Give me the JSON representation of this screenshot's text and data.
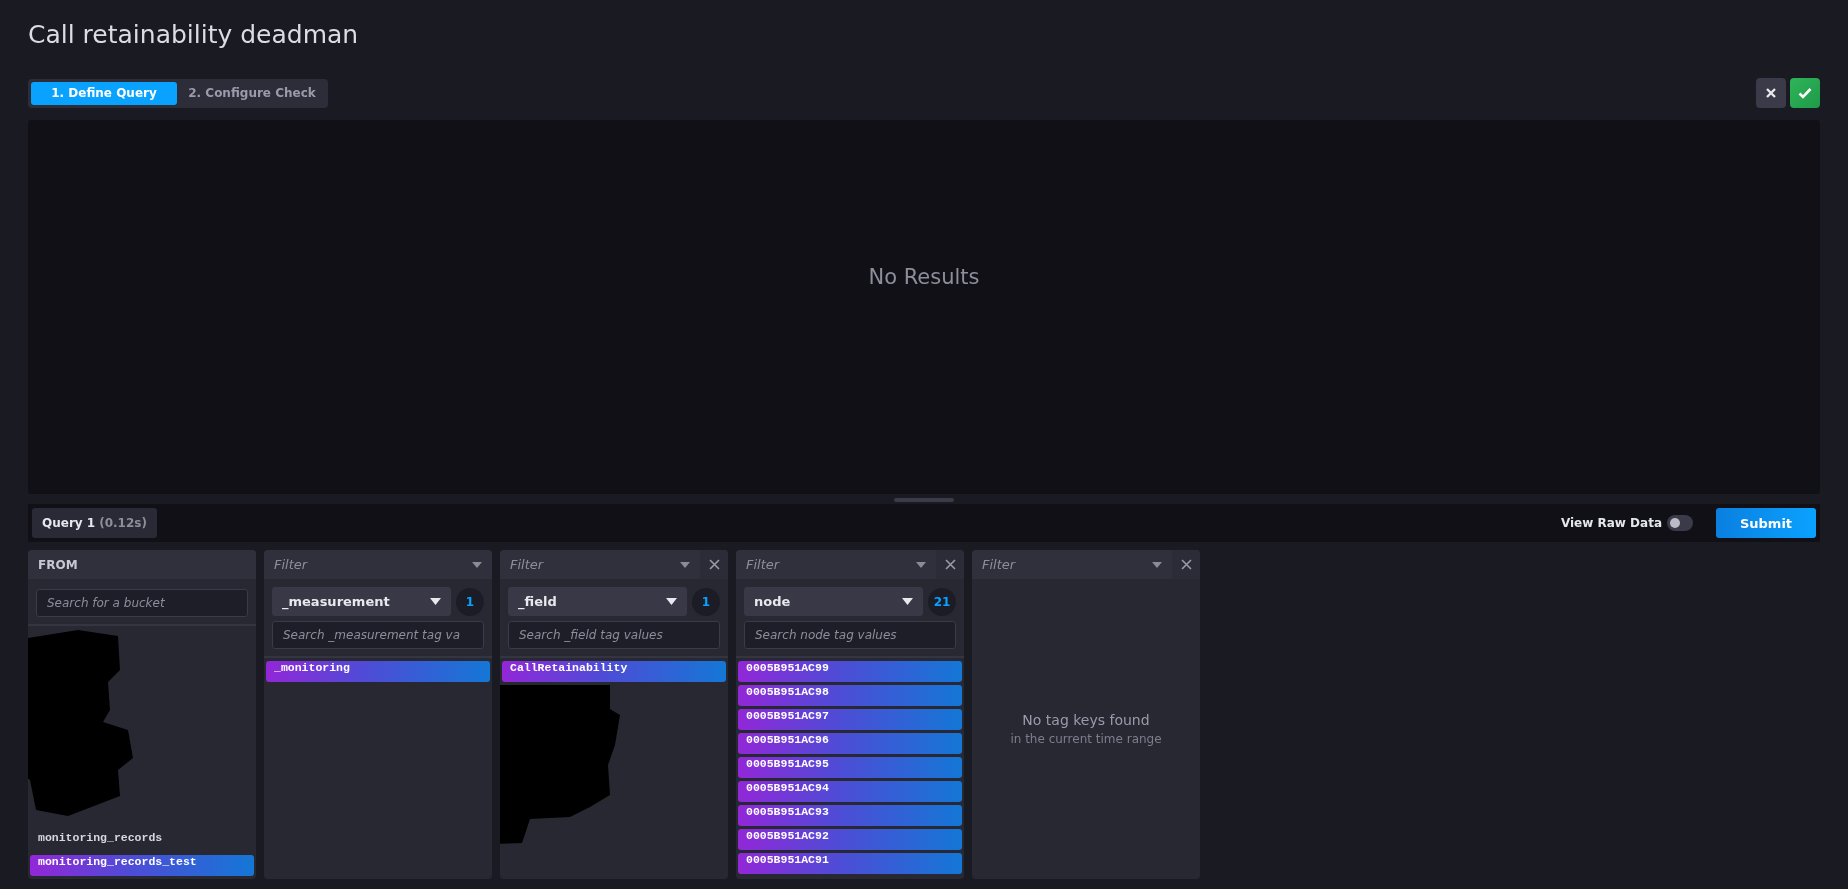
{
  "title": "Call retainability deadman",
  "steps": [
    {
      "label": "1. Define Query",
      "selected": true
    },
    {
      "label": "2. Configure Check",
      "selected": false
    }
  ],
  "graph": {
    "message": "No Results"
  },
  "query_tab": {
    "label": "Query 1",
    "timing": "(0.12s)"
  },
  "view_raw_data": {
    "label": "View Raw Data",
    "on": false
  },
  "submit": "Submit",
  "from": {
    "header": "FROM",
    "search_placeholder": "Search for a bucket",
    "buckets": [
      {
        "name": "monitoring_records",
        "selected": false
      },
      {
        "name": "monitoring_records_test",
        "selected": true
      }
    ]
  },
  "selectors": [
    {
      "kind": "keys",
      "filter_placeholder": "Filter",
      "closable": false,
      "key": "_measurement",
      "count": "1",
      "search_placeholder": "Search _measurement tag va",
      "values": [
        {
          "name": "_monitoring",
          "selected": true
        }
      ]
    },
    {
      "kind": "keys",
      "filter_placeholder": "Filter",
      "closable": true,
      "key": "_field",
      "count": "1",
      "search_placeholder": "Search _field tag values",
      "values": [
        {
          "name": "CallRetainability",
          "selected": true
        }
      ]
    },
    {
      "kind": "keys",
      "filter_placeholder": "Filter",
      "closable": true,
      "key": "node",
      "count": "21",
      "search_placeholder": "Search node tag values",
      "values": [
        {
          "name": "0005B951AC99",
          "selected": true
        },
        {
          "name": "0005B951AC98",
          "selected": true
        },
        {
          "name": "0005B951AC97",
          "selected": true
        },
        {
          "name": "0005B951AC96",
          "selected": true
        },
        {
          "name": "0005B951AC95",
          "selected": true
        },
        {
          "name": "0005B951AC94",
          "selected": true
        },
        {
          "name": "0005B951AC93",
          "selected": true
        },
        {
          "name": "0005B951AC92",
          "selected": true
        },
        {
          "name": "0005B951AC91",
          "selected": true
        }
      ]
    },
    {
      "kind": "empty",
      "filter_placeholder": "Filter",
      "closable": true,
      "message": "No tag keys found",
      "submessage": "in the current time range"
    }
  ]
}
